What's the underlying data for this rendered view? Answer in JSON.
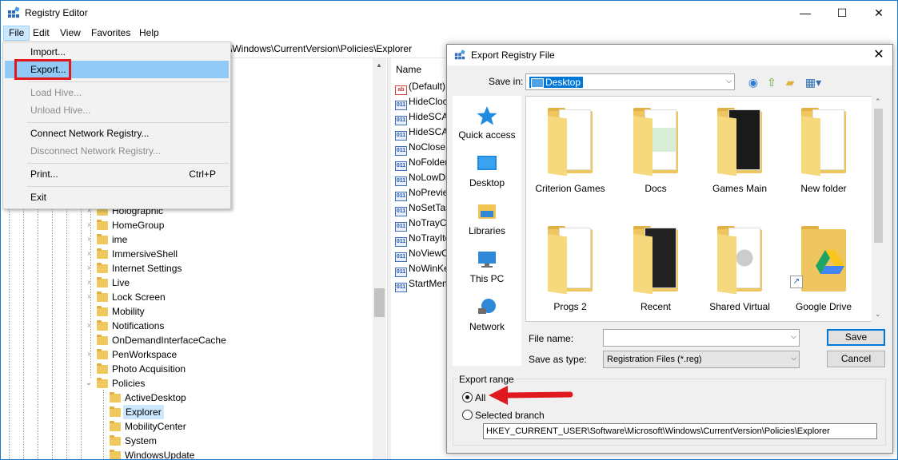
{
  "window": {
    "title": "Registry Editor",
    "minimize": "—",
    "maximize": "☐",
    "close": "✕"
  },
  "menubar": [
    "File",
    "Edit",
    "View",
    "Favorites",
    "Help"
  ],
  "address": "\\Windows\\CurrentVersion\\Policies\\Explorer",
  "file_menu": {
    "import": "Import...",
    "export": "Export...",
    "load_hive": "Load Hive...",
    "unload_hive": "Unload Hive...",
    "connect": "Connect Network Registry...",
    "disconnect": "Disconnect Network Registry...",
    "print": "Print...",
    "print_shortcut": "Ctrl+P",
    "exit": "Exit"
  },
  "tree": {
    "items": [
      "Holographic",
      "HomeGroup",
      "ime",
      "ImmersiveShell",
      "Internet Settings",
      "Live",
      "Lock Screen",
      "Mobility",
      "Notifications",
      "OnDemandInterfaceCache",
      "PenWorkspace",
      "Photo Acquisition",
      "Policies"
    ],
    "policies_children": [
      "ActiveDesktop",
      "Explorer",
      "MobilityCenter",
      "System",
      "WindowsUpdate"
    ]
  },
  "values": {
    "header": "Name",
    "rows": [
      "(Default)",
      "HideClock",
      "HideSCAHealth",
      "HideSCANetwork",
      "NoCloseDragDropBands",
      "NoFolderOptions",
      "NoLowDiskSpaceChecks",
      "NoPreviewPane",
      "NoSetTaskbar",
      "NoTrayContextMenu",
      "NoTrayItemsDisplay",
      "NoViewContextMenu",
      "NoWinKeys",
      "StartMenuLogOff"
    ]
  },
  "dialog": {
    "title": "Export Registry File",
    "save_in_label": "Save in:",
    "save_in_value": "Desktop",
    "places": [
      "Quick access",
      "Desktop",
      "Libraries",
      "This PC",
      "Network"
    ],
    "files": [
      "Criterion Games",
      "Docs",
      "Games Main",
      "New folder",
      "Progs 2",
      "Recent",
      "Shared Virtual",
      "Google Drive"
    ],
    "file_name_label": "File name:",
    "file_name_value": "",
    "save_as_type_label": "Save as type:",
    "save_as_type_value": "Registration Files (*.reg)",
    "save_button": "Save",
    "cancel_button": "Cancel",
    "export_range_label": "Export range",
    "radio_all": "All",
    "radio_selected": "Selected branch",
    "branch_path": "HKEY_CURRENT_USER\\Software\\Microsoft\\Windows\\CurrentVersion\\Policies\\Explorer"
  },
  "colors": {
    "highlight_red": "#e0191e",
    "selection_blue": "#0078d7",
    "menu_hover": "#91c9f7"
  }
}
